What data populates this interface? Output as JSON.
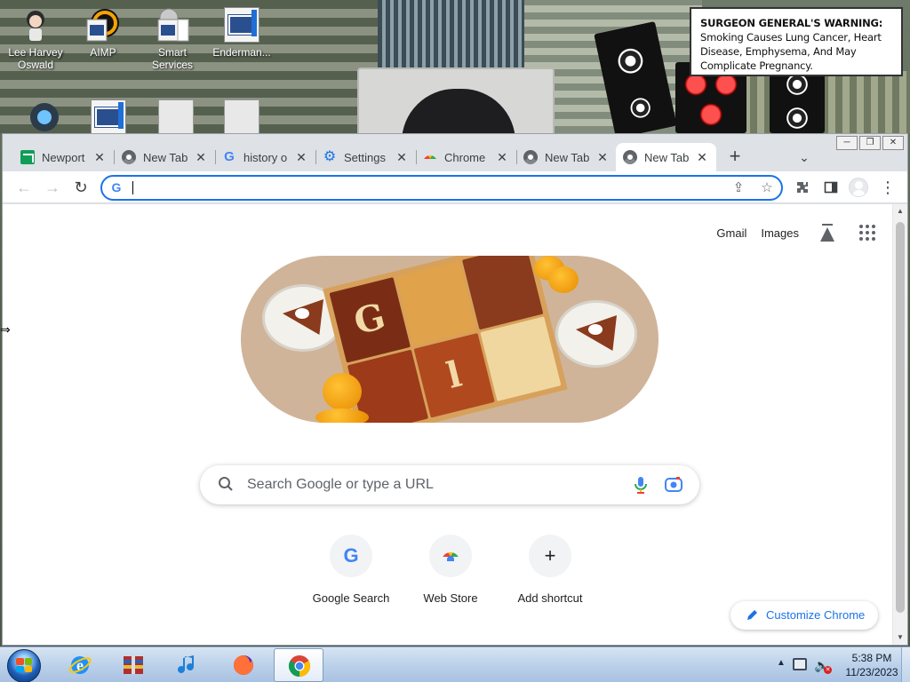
{
  "desktop": {
    "warning": {
      "bold": "SURGEON GENERAL'S WARNING:",
      "text": "Smoking Causes Lung Cancer, Heart Disease, Emphysema, And May Complicate Pregnancy."
    },
    "icons": [
      {
        "label": "Lee Harvey Oswald",
        "icon": "character-icon"
      },
      {
        "label": "AIMP",
        "icon": "aimp-icon"
      },
      {
        "label": "Smart Services",
        "icon": "gear-doc-icon"
      },
      {
        "label": "Enderman...",
        "icon": "doc-icon"
      }
    ]
  },
  "window": {
    "controls": {
      "minimize": "─",
      "restore": "❐",
      "close": "✕"
    },
    "tabs": [
      {
        "title": "Newport",
        "favicon": "newport-icon",
        "active": false
      },
      {
        "title": "New Tab",
        "favicon": "chrome-icon",
        "active": false
      },
      {
        "title": "history o",
        "favicon": "google-icon",
        "active": false
      },
      {
        "title": "Settings",
        "favicon": "gear-icon",
        "active": false
      },
      {
        "title": "Chrome",
        "favicon": "webstore-icon",
        "active": false
      },
      {
        "title": "New Tab",
        "favicon": "chrome-icon",
        "active": false
      },
      {
        "title": "New Tab",
        "favicon": "chrome-icon",
        "active": true
      }
    ],
    "tab_close_glyph": "✕",
    "new_tab_glyph": "+",
    "tab_search_glyph": "⌄",
    "toolbar": {
      "back": "←",
      "forward": "→",
      "reload": "↻",
      "omnibox_value": "",
      "google_g": "G",
      "share_glyph": "⇪",
      "bookmark_glyph": "☆",
      "extensions_glyph": "✦",
      "sidepanel_glyph": "◨",
      "menu_glyph": "⋮"
    }
  },
  "ntp": {
    "top_links": {
      "gmail": "Gmail",
      "images": "Images"
    },
    "doodle_letters": [
      "G",
      "l"
    ],
    "search_placeholder": "Search Google or type a URL",
    "shortcuts": [
      {
        "label": "Google Search",
        "icon": "google-g",
        "glyph": "G"
      },
      {
        "label": "Web Store",
        "icon": "webstore-icon",
        "glyph": ""
      },
      {
        "label": "Add shortcut",
        "icon": "plus-icon",
        "glyph": "+"
      }
    ],
    "customize_label": "Customize Chrome"
  },
  "taskbar": {
    "pinned": [
      {
        "name": "ie-icon"
      },
      {
        "name": "archive-icon"
      },
      {
        "name": "music-icon"
      },
      {
        "name": "firefox-icon"
      },
      {
        "name": "chrome-icon",
        "active": true
      }
    ],
    "tray": {
      "up_arrow": "▲",
      "time": "5:38 PM",
      "date": "11/23/2023"
    }
  },
  "colors": {
    "accent": "#1a73e8",
    "tabstrip_bg": "#dee1e6",
    "taskbar": "#bcd1ea"
  }
}
